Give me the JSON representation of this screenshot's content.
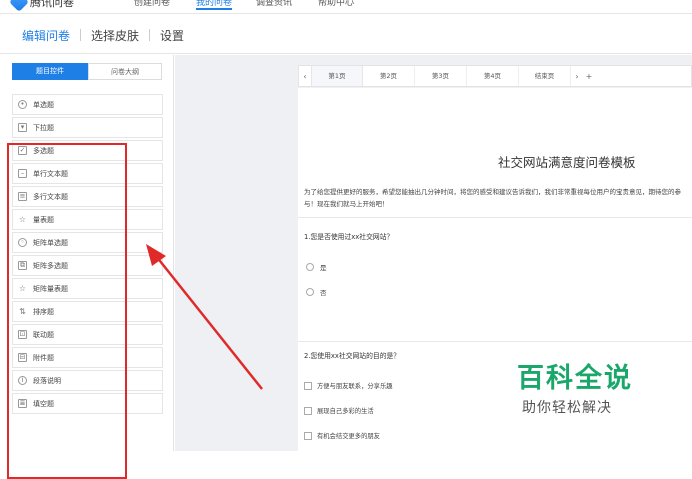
{
  "topnav": {
    "logo_text": "腾讯问卷",
    "items": [
      {
        "label": "创建问卷",
        "active": false
      },
      {
        "label": "我的问卷",
        "active": true
      },
      {
        "label": "调查资讯",
        "active": false
      },
      {
        "label": "帮助中心",
        "active": false
      }
    ]
  },
  "subnav": {
    "tabs": [
      {
        "label": "编辑问卷",
        "active": true
      },
      {
        "label": "选择皮肤",
        "active": false
      },
      {
        "label": "设置",
        "active": false
      }
    ]
  },
  "left_panel": {
    "tabs": [
      {
        "label": "题目控件",
        "active": true
      },
      {
        "label": "问卷大纲",
        "active": false
      }
    ],
    "items": [
      {
        "label": "单选题",
        "icon": "radio-icon"
      },
      {
        "label": "下拉题",
        "icon": "dropdown-icon"
      },
      {
        "label": "多选题",
        "icon": "checkbox-icon"
      },
      {
        "label": "单行文本题",
        "icon": "single-line-text-icon"
      },
      {
        "label": "多行文本题",
        "icon": "multi-line-text-icon"
      },
      {
        "label": "量表题",
        "icon": "star-icon"
      },
      {
        "label": "矩阵单选题",
        "icon": "matrix-radio-icon"
      },
      {
        "label": "矩阵多选题",
        "icon": "matrix-checkbox-icon"
      },
      {
        "label": "矩阵量表题",
        "icon": "matrix-star-icon"
      },
      {
        "label": "排序题",
        "icon": "sort-icon"
      },
      {
        "label": "联动题",
        "icon": "linkage-icon"
      },
      {
        "label": "附件题",
        "icon": "attachment-icon"
      },
      {
        "label": "段落说明",
        "icon": "info-icon"
      },
      {
        "label": "填空题",
        "icon": "fill-blank-icon"
      }
    ]
  },
  "page_tabs": {
    "prev": "‹",
    "items": [
      "第1页",
      "第2页",
      "第3页",
      "第4页",
      "结束页"
    ],
    "next": "›",
    "add": "+"
  },
  "survey": {
    "title": "社交网站满意度问卷模板",
    "intro": "为了给您提供更好的服务，希望您能抽出几分钟时间，将您的感受和建议告诉我们，我们非常重视每位用户的宝贵意见，期待您的参与！现在我们就马上开始吧！",
    "q1": {
      "title": "1.您是否使用过xx社交网站？",
      "options": [
        "是",
        "否"
      ]
    },
    "q2": {
      "title": "2.您使用xx社交网站的目的是？",
      "options": [
        "方便与朋友联系，分享乐趣",
        "展现自己多彩的生活",
        "有机会结交更多的朋友"
      ]
    }
  },
  "watermark": {
    "main": "百科全说",
    "sub": "助你轻松解决"
  },
  "colors": {
    "accent": "#1e7fe6",
    "highlight": "#e02a2a",
    "watermark": "#1ba76b"
  }
}
